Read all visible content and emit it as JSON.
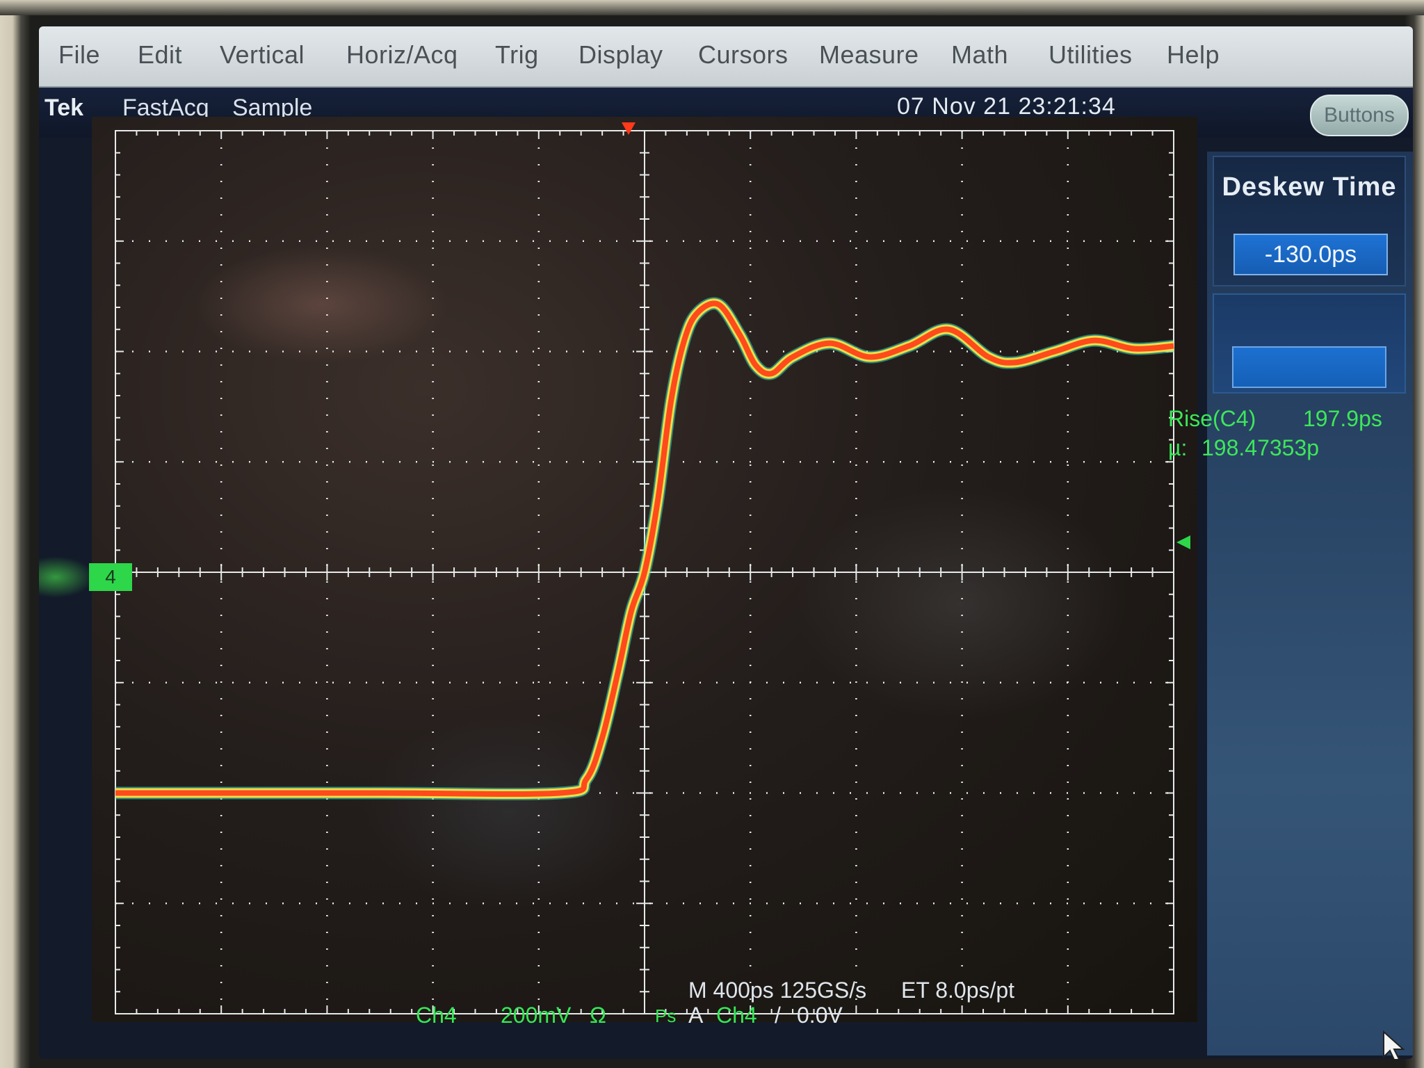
{
  "menu": {
    "items": [
      "File",
      "Edit",
      "Vertical",
      "Horiz/Acq",
      "Trig",
      "Display",
      "Cursors",
      "Measure",
      "Math",
      "Utilities",
      "Help"
    ]
  },
  "status": {
    "brand": "Tek",
    "mode": "FastAcq",
    "acq": "Sample",
    "datetime": "07 Nov 21 23:21:34",
    "buttons_label": "Buttons"
  },
  "side_panel": {
    "title": "Deskew Time",
    "value": "-130.0ps",
    "second_field_value": ""
  },
  "measurements": {
    "rise_label": "Rise(C4)",
    "rise_value": "197.9ps",
    "mean_label": "µ:",
    "mean_value": "198.47353p"
  },
  "channel": {
    "marker": "4",
    "name": "Ch4",
    "scale": "200mV",
    "coupling_icon": "Ω"
  },
  "timebase": {
    "line1": "M 400ps 125GS/s",
    "line1b": "ET 8.0ps/pt",
    "trig_prefix": "Ps",
    "trig_mode": "A",
    "trig_source": "Ch4",
    "trig_slope": "/",
    "trig_level": "0.0V"
  },
  "colors": {
    "trace_core": "#ff4a1c",
    "trace_edge": "#e6e04a",
    "graticule": "#e6eaea",
    "readout_green": "#35e657"
  },
  "waveform": {
    "unit_time": "ps",
    "unit_volt": "mV",
    "points": [
      [
        -2000,
        -400
      ],
      [
        -1000,
        -400
      ],
      [
        -320,
        -400
      ],
      [
        -220,
        -375
      ],
      [
        -160,
        -300
      ],
      [
        -100,
        -180
      ],
      [
        -50,
        -70
      ],
      [
        0,
        0
      ],
      [
        50,
        130
      ],
      [
        100,
        310
      ],
      [
        150,
        420
      ],
      [
        200,
        470
      ],
      [
        280,
        485
      ],
      [
        360,
        430
      ],
      [
        420,
        375
      ],
      [
        480,
        360
      ],
      [
        560,
        390
      ],
      [
        700,
        415
      ],
      [
        850,
        390
      ],
      [
        1000,
        410
      ],
      [
        1150,
        440
      ],
      [
        1300,
        390
      ],
      [
        1400,
        380
      ],
      [
        1550,
        400
      ],
      [
        1700,
        420
      ],
      [
        1850,
        405
      ],
      [
        2000,
        410
      ]
    ]
  }
}
